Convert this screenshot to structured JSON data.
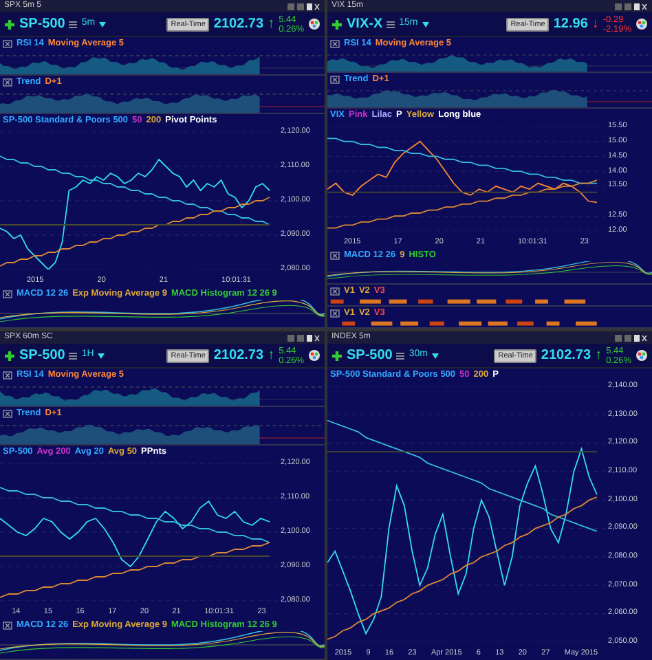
{
  "panels": [
    {
      "title": "SPX 5m 5",
      "symbol": "SP-500",
      "interval": "5m",
      "realtime": "Real-Time",
      "price": "2102.73",
      "arrow": "↑",
      "change": "5.44",
      "change_pct": "0.26%",
      "negative": false,
      "subcharts": [
        {
          "kind": "oscillator",
          "legend": [
            {
              "text": "RSI 14",
              "color": "#33aaff"
            },
            {
              "text": "Moving Average 5",
              "color": "#ff8833"
            }
          ]
        },
        {
          "kind": "trend",
          "legend": [
            {
              "text": "Trend",
              "color": "#33aaff"
            },
            {
              "text": "D+1",
              "color": "#ff8833"
            }
          ]
        }
      ],
      "main": {
        "legend": [
          {
            "text": "SP-500 Standard & Poors 500",
            "color": "#33aaff"
          },
          {
            "text": "50",
            "color": "#cc33cc"
          },
          {
            "text": "200",
            "color": "#ddaa33"
          },
          {
            "text": "Pivot Points",
            "color": "#ffffff"
          }
        ],
        "chart_data": {
          "type": "line",
          "grid": true,
          "ylim": [
            2080,
            2120
          ],
          "yticks": [
            {
              "value": 2120,
              "label": "2,120.00"
            },
            {
              "value": 2110,
              "label": "2,110.00"
            },
            {
              "value": 2100,
              "label": "2,100.00"
            },
            {
              "value": 2090,
              "label": "2,090.00"
            },
            {
              "value": 2080,
              "label": "2,080.00"
            }
          ],
          "series": [
            {
              "color": "#33ddee",
              "values": [
                2092,
                2091,
                2089,
                2090,
                2086,
                2084,
                2082,
                2080,
                2082,
                2088,
                2103,
                2104,
                2106,
                2105,
                2107,
                2106,
                2108,
                2107,
                2105,
                2106,
                2108,
                2107,
                2109,
                2112,
                2110,
                2108,
                2107,
                2104,
                2106,
                2103,
                2105,
                2104,
                2106,
                2102,
                2101,
                2098,
                2100,
                2104,
                2105,
                2103
              ]
            },
            {
              "color": "#33bbdd",
              "values": [
                2113,
                2112,
                2112,
                2111,
                2111,
                2110,
                2110,
                2109,
                2109,
                2108,
                2108,
                2107,
                2107,
                2106,
                2106,
                2105,
                2105,
                2104,
                2104,
                2103,
                2103,
                2102,
                2102,
                2101,
                2101,
                2100,
                2100,
                2099,
                2099,
                2098,
                2098,
                2097,
                2097,
                2096,
                2096,
                2095,
                2095,
                2094,
                2094,
                2093
              ]
            },
            {
              "color": "#dd8833",
              "values": [
                2081,
                2082,
                2082,
                2083,
                2083,
                2084,
                2084,
                2085,
                2085,
                2086,
                2086,
                2087,
                2087,
                2088,
                2088,
                2089,
                2089,
                2090,
                2090,
                2091,
                2091,
                2092,
                2092,
                2093,
                2093,
                2094,
                2094,
                2095,
                2095,
                2096,
                2096,
                2097,
                2097,
                2098,
                2098,
                2099,
                2099,
                2100,
                2100,
                2101
              ]
            },
            {
              "color": "#4a4a30",
              "values": [
                2093,
                2093,
                2093,
                2093,
                2093,
                2093,
                2093,
                2093,
                2093,
                2093,
                2093,
                2093,
                2093,
                2093,
                2093,
                2093,
                2093,
                2093,
                2093,
                2093,
                2093,
                2093,
                2093,
                2093,
                2093,
                2093,
                2093,
                2093,
                2093,
                2093,
                2093,
                2093,
                2093,
                2093,
                2093,
                2093,
                2093,
                2093,
                2093,
                2093
              ]
            }
          ]
        },
        "x_labels": [
          "2015",
          "20",
          "21",
          "10:01:31"
        ]
      },
      "lower": [
        {
          "kind": "macd",
          "legend": [
            {
              "text": "MACD 12 26",
              "color": "#33aaff"
            },
            {
              "text": "Exp Moving Average 9",
              "color": "#ddaa33"
            },
            {
              "text": "MACD Histogram 12 26 9",
              "color": "#33cc33"
            }
          ]
        }
      ]
    },
    {
      "title": "VIX 15m",
      "symbol": "VIX-X",
      "interval": "15m",
      "realtime": "Real-Time",
      "price": "12.96",
      "arrow": "↓",
      "change": "-0.29",
      "change_pct": "-2.19%",
      "negative": true,
      "subcharts": [
        {
          "kind": "oscillator",
          "legend": [
            {
              "text": "RSI 14",
              "color": "#33aaff"
            },
            {
              "text": "Moving Average 5",
              "color": "#ff8833"
            }
          ]
        },
        {
          "kind": "trend",
          "legend": [
            {
              "text": "Trend",
              "color": "#33aaff"
            },
            {
              "text": "D+1",
              "color": "#ff8833"
            }
          ]
        }
      ],
      "main": {
        "legend": [
          {
            "text": "VIX",
            "color": "#33aaff"
          },
          {
            "text": "Pink",
            "color": "#cc33cc"
          },
          {
            "text": "Lilac",
            "color": "#aaaaff"
          },
          {
            "text": "P",
            "color": "#ffffff"
          },
          {
            "text": "Yellow",
            "color": "#ddaa33"
          },
          {
            "text": "Long blue",
            "color": "#ffffff"
          }
        ],
        "chart_data": {
          "type": "line",
          "grid": true,
          "ylim": [
            12,
            15.5
          ],
          "yticks": [
            {
              "value": 15.5,
              "label": "15.50"
            },
            {
              "value": 15,
              "label": "15.00"
            },
            {
              "value": 14.5,
              "label": "14.50"
            },
            {
              "value": 14,
              "label": "14.00"
            },
            {
              "value": 13.5,
              "label": "13.50"
            },
            {
              "value": 12.5,
              "label": "12.50"
            },
            {
              "value": 12,
              "label": "12.00"
            }
          ],
          "series": [
            {
              "color": "#ff8833",
              "values": [
                13.4,
                13.6,
                13.3,
                13.2,
                13.5,
                13.7,
                13.9,
                13.8,
                14.3,
                14.6,
                14.8,
                15.0,
                14.7,
                14.4,
                14.0,
                13.6,
                13.3,
                13.2,
                13.4,
                13.3,
                13.5,
                13.4,
                13.3,
                13.5,
                13.4,
                13.6,
                13.5,
                13.4,
                13.6,
                13.5,
                13.3,
                13.0,
                12.96
              ]
            },
            {
              "color": "#33bbdd",
              "values": [
                15.1,
                15.1,
                15.0,
                15.0,
                14.9,
                14.9,
                14.8,
                14.8,
                14.7,
                14.7,
                14.6,
                14.6,
                14.5,
                14.5,
                14.4,
                14.4,
                14.3,
                14.3,
                14.2,
                14.2,
                14.1,
                14.1,
                14.0,
                14.0,
                13.9,
                13.9,
                13.8,
                13.8,
                13.7,
                13.7,
                13.6,
                13.6,
                13.6
              ]
            },
            {
              "color": "#dd8833",
              "values": [
                12.1,
                12.1,
                12.2,
                12.2,
                12.3,
                12.3,
                12.4,
                12.4,
                12.5,
                12.5,
                12.6,
                12.6,
                12.7,
                12.7,
                12.8,
                12.8,
                12.9,
                12.9,
                13.0,
                13.0,
                13.1,
                13.1,
                13.2,
                13.2,
                13.3,
                13.3,
                13.4,
                13.4,
                13.5,
                13.5,
                13.6,
                13.6,
                13.7
              ]
            },
            {
              "color": "#4a4a30",
              "values": [
                13.3,
                13.3,
                13.3,
                13.3,
                13.3,
                13.3,
                13.3,
                13.3,
                13.3,
                13.3,
                13.3,
                13.3,
                13.3,
                13.3,
                13.3,
                13.3,
                13.3,
                13.3,
                13.3,
                13.3,
                13.3,
                13.3,
                13.3,
                13.3,
                13.3,
                13.3,
                13.3,
                13.3,
                13.3,
                13.3,
                13.3,
                13.3,
                13.3
              ]
            }
          ]
        },
        "x_labels": [
          "2015",
          "17",
          "20",
          "21",
          "10:01:31",
          "23"
        ]
      },
      "lower": [
        {
          "kind": "macd",
          "legend": [
            {
              "text": "MACD 12 26",
              "color": "#33aaff"
            },
            {
              "text": "9",
              "color": "#ddaa33"
            },
            {
              "text": "HISTO",
              "color": "#33cc33"
            }
          ]
        },
        {
          "kind": "strip",
          "legend": [
            {
              "text": "V1",
              "color": "#ddaa33"
            },
            {
              "text": "V2",
              "color": "#ddaa33"
            },
            {
              "text": "V3",
              "color": "#ff4444"
            }
          ]
        },
        {
          "kind": "strip",
          "legend": [
            {
              "text": "V1",
              "color": "#ddaa33"
            },
            {
              "text": "V2",
              "color": "#ddaa33"
            },
            {
              "text": "V3",
              "color": "#ff4444"
            }
          ]
        }
      ]
    },
    {
      "title": "SPX 60m SC",
      "symbol": "SP-500",
      "interval": "1H",
      "realtime": "Real-Time",
      "price": "2102.73",
      "arrow": "↑",
      "change": "5.44",
      "change_pct": "0.26%",
      "negative": false,
      "subcharts": [
        {
          "kind": "oscillator",
          "legend": [
            {
              "text": "RSI 14",
              "color": "#33aaff"
            },
            {
              "text": "Moving Average 5",
              "color": "#ff8833"
            }
          ]
        },
        {
          "kind": "trend",
          "legend": [
            {
              "text": "Trend",
              "color": "#33aaff"
            },
            {
              "text": "D+1",
              "color": "#ff8833"
            }
          ]
        }
      ],
      "main": {
        "legend": [
          {
            "text": "SP-500",
            "color": "#33aaff"
          },
          {
            "text": "Avg 200",
            "color": "#cc33cc"
          },
          {
            "text": "Avg 20",
            "color": "#33aaff"
          },
          {
            "text": "Avg 50",
            "color": "#ddaa33"
          },
          {
            "text": "PPnts",
            "color": "#ffffff"
          }
        ],
        "chart_data": {
          "type": "line",
          "grid": true,
          "ylim": [
            2080,
            2120
          ],
          "yticks": [
            {
              "value": 2120,
              "label": "2,120.00"
            },
            {
              "value": 2110,
              "label": "2,110.00"
            },
            {
              "value": 2100,
              "label": "2,100.00"
            },
            {
              "value": 2090,
              "label": "2,090.00"
            },
            {
              "value": 2080,
              "label": "2,080.00"
            }
          ],
          "series": [
            {
              "color": "#33ddee",
              "values": [
                2104,
                2102,
                2100,
                2099,
                2101,
                2104,
                2103,
                2100,
                2098,
                2100,
                2103,
                2104,
                2101,
                2097,
                2092,
                2090,
                2093,
                2098,
                2103,
                2106,
                2104,
                2101,
                2103,
                2107,
                2109,
                2105,
                2104,
                2106,
                2103,
                2102,
                2104,
                2103
              ]
            },
            {
              "color": "#33bbdd",
              "values": [
                2113,
                2112,
                2112,
                2111,
                2111,
                2110,
                2110,
                2109,
                2109,
                2108,
                2108,
                2107,
                2107,
                2106,
                2106,
                2105,
                2105,
                2104,
                2104,
                2103,
                2103,
                2102,
                2102,
                2101,
                2101,
                2100,
                2100,
                2099,
                2099,
                2098,
                2098,
                2097
              ]
            },
            {
              "color": "#dd8833",
              "values": [
                2081,
                2082,
                2082,
                2083,
                2083,
                2084,
                2084,
                2085,
                2085,
                2086,
                2086,
                2087,
                2087,
                2088,
                2088,
                2089,
                2089,
                2090,
                2090,
                2091,
                2091,
                2092,
                2092,
                2093,
                2093,
                2094,
                2094,
                2095,
                2095,
                2096,
                2096,
                2097
              ]
            },
            {
              "color": "#4a4a30",
              "values": [
                2093,
                2093,
                2093,
                2093,
                2093,
                2093,
                2093,
                2093,
                2093,
                2093,
                2093,
                2093,
                2093,
                2093,
                2093,
                2093,
                2093,
                2093,
                2093,
                2093,
                2093,
                2093,
                2093,
                2093,
                2093,
                2093,
                2093,
                2093,
                2093,
                2093,
                2093,
                2093
              ]
            }
          ]
        },
        "x_labels": [
          "14",
          "15",
          "16",
          "17",
          "20",
          "21",
          "10:01:31",
          "23"
        ]
      },
      "lower": [
        {
          "kind": "macd",
          "legend": [
            {
              "text": "MACD 12 26",
              "color": "#33aaff"
            },
            {
              "text": "Exp Moving Average 9",
              "color": "#ddaa33"
            },
            {
              "text": "MACD Histogram 12 26 9",
              "color": "#33cc33"
            }
          ]
        }
      ]
    },
    {
      "title": "INDEX 5m",
      "symbol": "SP-500",
      "interval": "30m",
      "realtime": "Real-Time",
      "price": "2102.73",
      "arrow": "↑",
      "change": "5.44",
      "change_pct": "0.26%",
      "negative": false,
      "main": {
        "legend": [
          {
            "text": "SP-500 Standard & Poors 500",
            "color": "#33aaff"
          },
          {
            "text": "50",
            "color": "#cc33cc"
          },
          {
            "text": "200",
            "color": "#ddaa33"
          },
          {
            "text": "P",
            "color": "#ffffff"
          }
        ],
        "chart_data": {
          "type": "line",
          "grid": true,
          "ylim": [
            2050,
            2140
          ],
          "yticks": [
            {
              "value": 2140,
              "label": "2,140.00"
            },
            {
              "value": 2130,
              "label": "2,130.00"
            },
            {
              "value": 2120,
              "label": "2,120.00"
            },
            {
              "value": 2110,
              "label": "2,110.00"
            },
            {
              "value": 2100,
              "label": "2,100.00"
            },
            {
              "value": 2090,
              "label": "2,090.00"
            },
            {
              "value": 2080,
              "label": "2,080.00"
            },
            {
              "value": 2070,
              "label": "2,070.00"
            },
            {
              "value": 2060,
              "label": "2,060.00"
            },
            {
              "value": 2050,
              "label": "2,050.00"
            }
          ],
          "series": [
            {
              "color": "#33ddee",
              "values": [
                2078,
                2082,
                2075,
                2068,
                2060,
                2053,
                2058,
                2066,
                2090,
                2105,
                2098,
                2082,
                2070,
                2076,
                2088,
                2095,
                2080,
                2067,
                2074,
                2090,
                2100,
                2094,
                2082,
                2070,
                2080,
                2098,
                2106,
                2112,
                2102,
                2090,
                2085,
                2095,
                2110,
                2118,
                2108,
                2102
              ]
            },
            {
              "color": "#33bbdd",
              "values": [
                2128,
                2127,
                2126,
                2125,
                2124,
                2122,
                2121,
                2120,
                2119,
                2118,
                2117,
                2116,
                2115,
                2113,
                2112,
                2111,
                2110,
                2109,
                2108,
                2107,
                2106,
                2104,
                2103,
                2102,
                2101,
                2100,
                2099,
                2098,
                2097,
                2095,
                2094,
                2093,
                2092,
                2091,
                2090,
                2089
              ]
            },
            {
              "color": "#dd8833",
              "values": [
                2051,
                2052,
                2054,
                2055,
                2057,
                2058,
                2060,
                2061,
                2062,
                2064,
                2065,
                2067,
                2068,
                2070,
                2071,
                2072,
                2074,
                2075,
                2077,
                2078,
                2080,
                2081,
                2082,
                2084,
                2085,
                2087,
                2088,
                2090,
                2091,
                2092,
                2094,
                2095,
                2097,
                2098,
                2100,
                2101
              ]
            },
            {
              "color": "#4a4a30",
              "values": [
                2117,
                2117,
                2117,
                2117,
                2117,
                2117,
                2117,
                2117,
                2117,
                2117,
                2117,
                2117,
                2117,
                2117,
                2117,
                2117,
                2117,
                2117,
                2117,
                2117,
                2117,
                2117,
                2117,
                2117,
                2117,
                2117,
                2117,
                2117,
                2117,
                2117,
                2117,
                2117,
                2117,
                2117,
                2117,
                2117
              ]
            }
          ]
        },
        "x_labels": [
          "2015",
          "9",
          "16",
          "23",
          "Apr 2015",
          "6",
          "13",
          "20",
          "27",
          "May 2015"
        ]
      }
    }
  ]
}
